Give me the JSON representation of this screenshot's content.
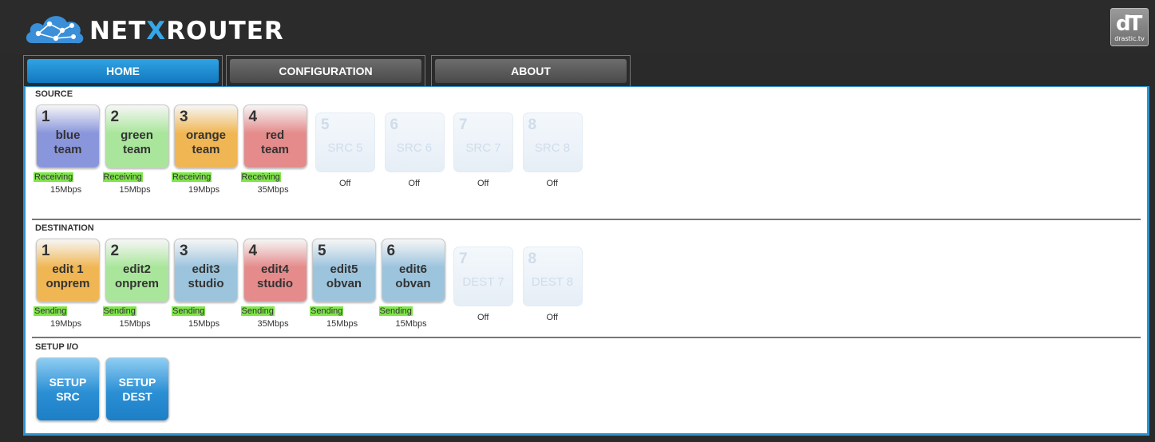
{
  "app": {
    "title_pre": "NET",
    "title_x": "X",
    "title_post": "ROUTER",
    "corner_logo_glyph": "dT",
    "corner_logo_caption": "drastic.tv"
  },
  "tabs": [
    {
      "label": "HOME",
      "active": true
    },
    {
      "label": "CONFIGURATION",
      "active": false
    },
    {
      "label": "ABOUT",
      "active": false
    }
  ],
  "source": {
    "label": "SOURCE",
    "tiles": [
      {
        "num": "1",
        "name": "blue\nteam",
        "color": "#8a96dc",
        "status": "Receiving",
        "rate": "15Mbps"
      },
      {
        "num": "2",
        "name": "green\nteam",
        "color": "#a9e69b",
        "status": "Receiving",
        "rate": "15Mbps"
      },
      {
        "num": "3",
        "name": "orange\nteam",
        "color": "#f0b653",
        "status": "Receiving",
        "rate": "19Mbps"
      },
      {
        "num": "4",
        "name": "red\nteam",
        "color": "#e58b8b",
        "status": "Receiving",
        "rate": "35Mbps"
      },
      {
        "num": "5",
        "name": "SRC 5",
        "off": "Off"
      },
      {
        "num": "6",
        "name": "SRC 6",
        "off": "Off"
      },
      {
        "num": "7",
        "name": "SRC 7",
        "off": "Off"
      },
      {
        "num": "8",
        "name": "SRC 8",
        "off": "Off"
      }
    ]
  },
  "destination": {
    "label": "DESTINATION",
    "tiles": [
      {
        "num": "1",
        "name": "edit 1\nonprem",
        "color": "#f0b653",
        "status": "Sending",
        "rate": "19Mbps"
      },
      {
        "num": "2",
        "name": "edit2\nonprem",
        "color": "#a9e69b",
        "status": "Sending",
        "rate": "15Mbps"
      },
      {
        "num": "3",
        "name": "edit3\nstudio",
        "color": "#9cc4dd",
        "status": "Sending",
        "rate": "15Mbps"
      },
      {
        "num": "4",
        "name": "edit4\nstudio",
        "color": "#e58b8b",
        "status": "Sending",
        "rate": "35Mbps"
      },
      {
        "num": "5",
        "name": "edit5\nobvan",
        "color": "#9cc4dd",
        "status": "Sending",
        "rate": "15Mbps"
      },
      {
        "num": "6",
        "name": "edit6\nobvan",
        "color": "#9cc4dd",
        "status": "Sending",
        "rate": "15Mbps"
      },
      {
        "num": "7",
        "name": "DEST 7",
        "off": "Off"
      },
      {
        "num": "8",
        "name": "DEST 8",
        "off": "Off"
      }
    ]
  },
  "setup": {
    "label": "SETUP I/O",
    "buttons": [
      {
        "label": "SETUP\nSRC"
      },
      {
        "label": "SETUP\nDEST"
      }
    ]
  }
}
